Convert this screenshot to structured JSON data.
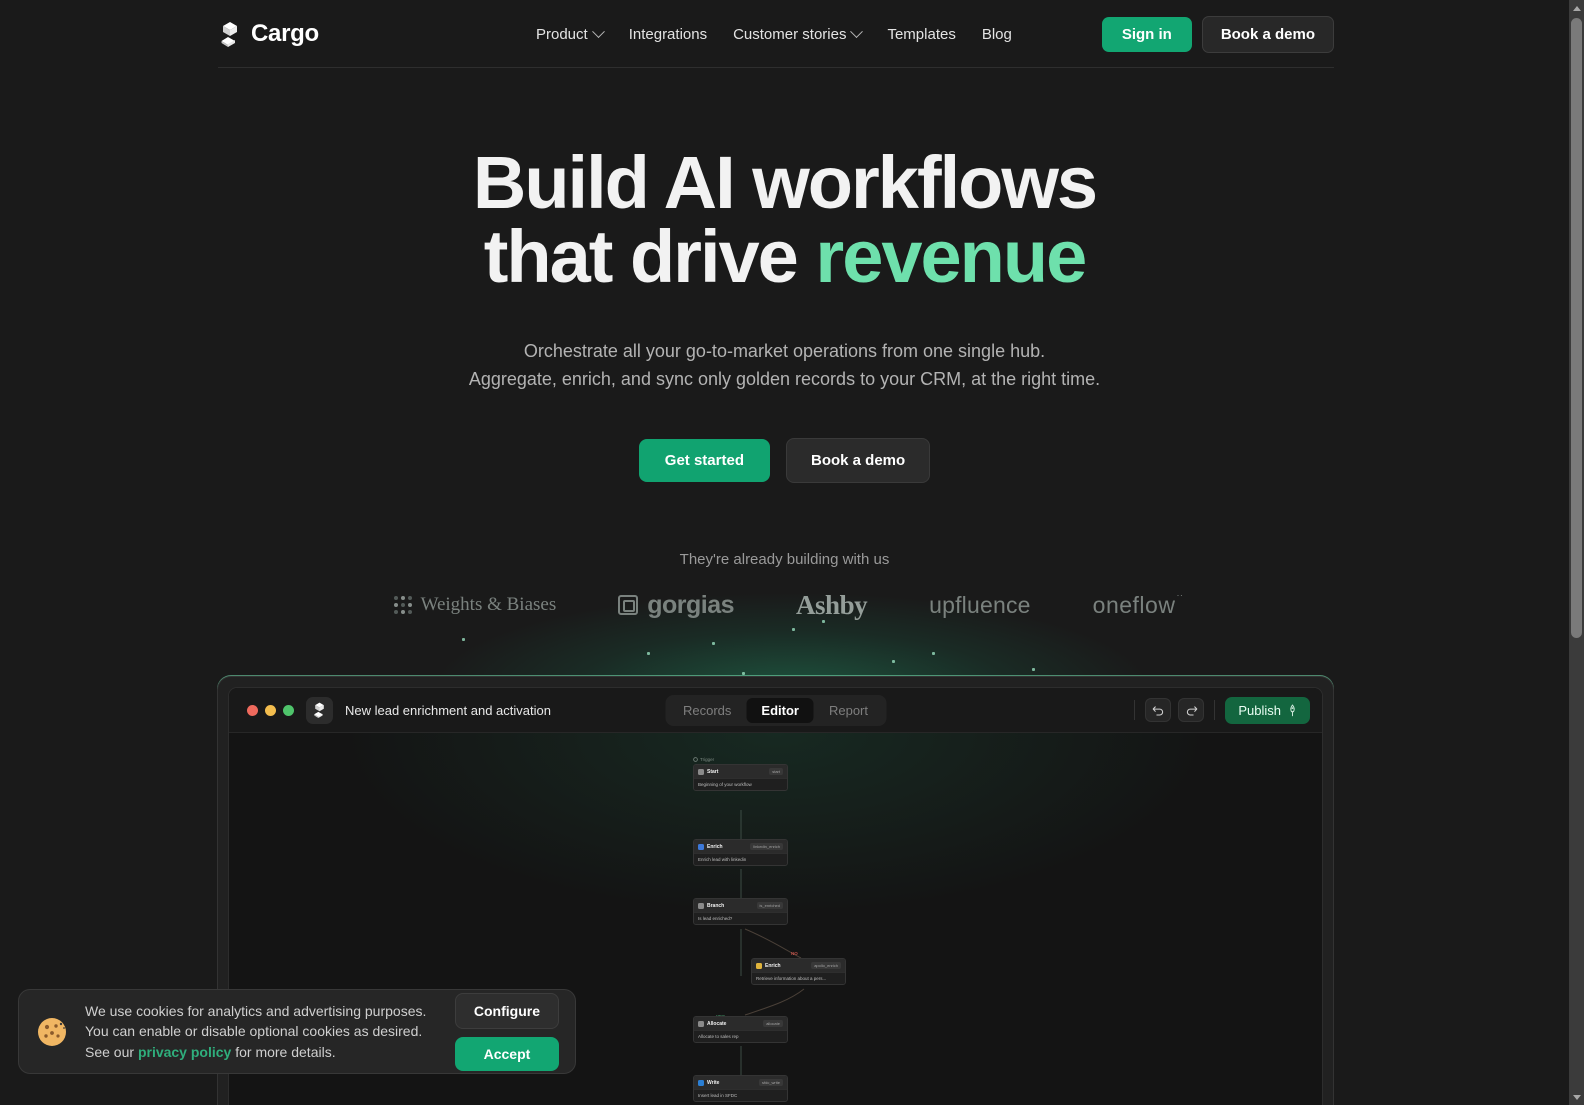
{
  "brand": {
    "name": "Cargo",
    "logo_icon": "cargo-boxes-icon"
  },
  "nav": {
    "links": [
      {
        "label": "Product",
        "has_dropdown": true
      },
      {
        "label": "Integrations",
        "has_dropdown": false
      },
      {
        "label": "Customer stories",
        "has_dropdown": true
      },
      {
        "label": "Templates",
        "has_dropdown": false
      },
      {
        "label": "Blog",
        "has_dropdown": false
      }
    ],
    "sign_in": "Sign in",
    "book_demo": "Book a demo"
  },
  "hero": {
    "title_line1": "Build AI workflows",
    "title_line2_prefix": "that drive ",
    "title_accent": "revenue",
    "sub_line1": "Orchestrate all your go-to-market operations from one single hub.",
    "sub_line2": "Aggregate, enrich, and sync only golden records to your CRM, at the right time.",
    "cta_primary": "Get started",
    "cta_secondary": "Book a demo"
  },
  "social_proof": {
    "caption": "They're already building with us",
    "logos": [
      {
        "name": "Weights & Biases"
      },
      {
        "name": "gorgias"
      },
      {
        "name": "Ashby"
      },
      {
        "name": "upfluence"
      },
      {
        "name": "oneflow"
      }
    ]
  },
  "app": {
    "title": "New lead enrichment and activation",
    "tabs": [
      {
        "label": "Records",
        "active": false
      },
      {
        "label": "Editor",
        "active": true
      },
      {
        "label": "Report",
        "active": false
      }
    ],
    "undo_icon": "undo-icon",
    "redo_icon": "redo-icon",
    "publish": "Publish",
    "publish_icon": "rocket-icon",
    "workflow": {
      "group_label": "Trigger",
      "nodes": [
        {
          "name": "Start",
          "badge": "start",
          "desc": "Beginning of your workflow",
          "icon_color": "#8a8a8a"
        },
        {
          "name": "Enrich",
          "badge": "linkedin_enrich",
          "desc": "Enrich lead with linkedin",
          "icon_color": "#3c78d8"
        },
        {
          "name": "Branch",
          "badge": "is_enriched",
          "desc": "Is lead enriched?",
          "icon_color": "#8a8a8a"
        },
        {
          "name": "Enrich",
          "badge": "apollo_enrich",
          "desc": "Retrieve information about a pers...",
          "icon_color": "#e0b43c"
        },
        {
          "name": "Allocate",
          "badge": "allocate",
          "desc": "Allocate to sales rep",
          "icon_color": "#8a8a8a"
        },
        {
          "name": "Write",
          "badge": "sfdc_write",
          "desc": "Insert lead in SFDC",
          "icon_color": "#2b7fd4"
        }
      ],
      "edge_labels": [
        {
          "text": "NO",
          "color": "#c4524a"
        },
        {
          "text": "YES",
          "color": "#3f8c62"
        }
      ]
    }
  },
  "cookie_banner": {
    "icon": "cookie-icon",
    "line1": "We use cookies for analytics and advertising purposes.",
    "line2": "You can enable or disable optional cookies as desired.",
    "line3_prefix": "See our ",
    "link": "privacy policy",
    "line3_suffix": " for more details.",
    "configure": "Configure",
    "accept": "Accept"
  },
  "colors": {
    "accent_green": "#12a672",
    "accent_mint": "#6ee0ac",
    "page_bg": "#1a1a1a"
  }
}
